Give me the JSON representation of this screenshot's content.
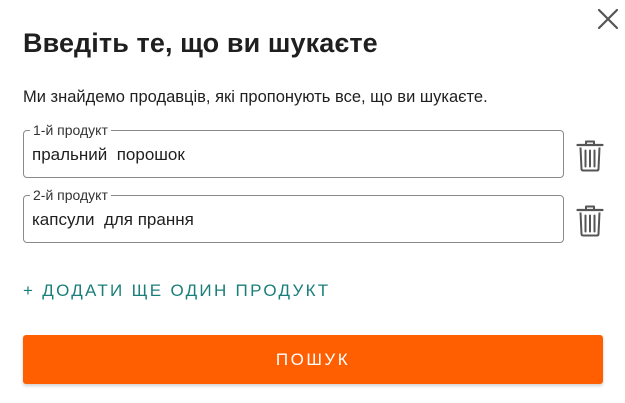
{
  "dialog": {
    "title": "Введіть те, що ви шукаєте",
    "subtitle": "Ми знайдемо продавців, які пропонують все, що ви шукаєте.",
    "close_icon": "close-icon"
  },
  "products": [
    {
      "label": "1-й продукт",
      "value": "пральний  порошок",
      "delete_icon": "trash-icon"
    },
    {
      "label": "2-й продукт",
      "value": "капсули  для прання",
      "delete_icon": "trash-icon"
    }
  ],
  "add_product_label": "+ ДОДАТИ ЩЕ ОДИН ПРОДУКТ",
  "search_button_label": "ПОШУК",
  "colors": {
    "accent": "#ff5f00",
    "link": "#1a7f7a",
    "text": "#1f1f1f",
    "border": "#8a8a8a"
  }
}
